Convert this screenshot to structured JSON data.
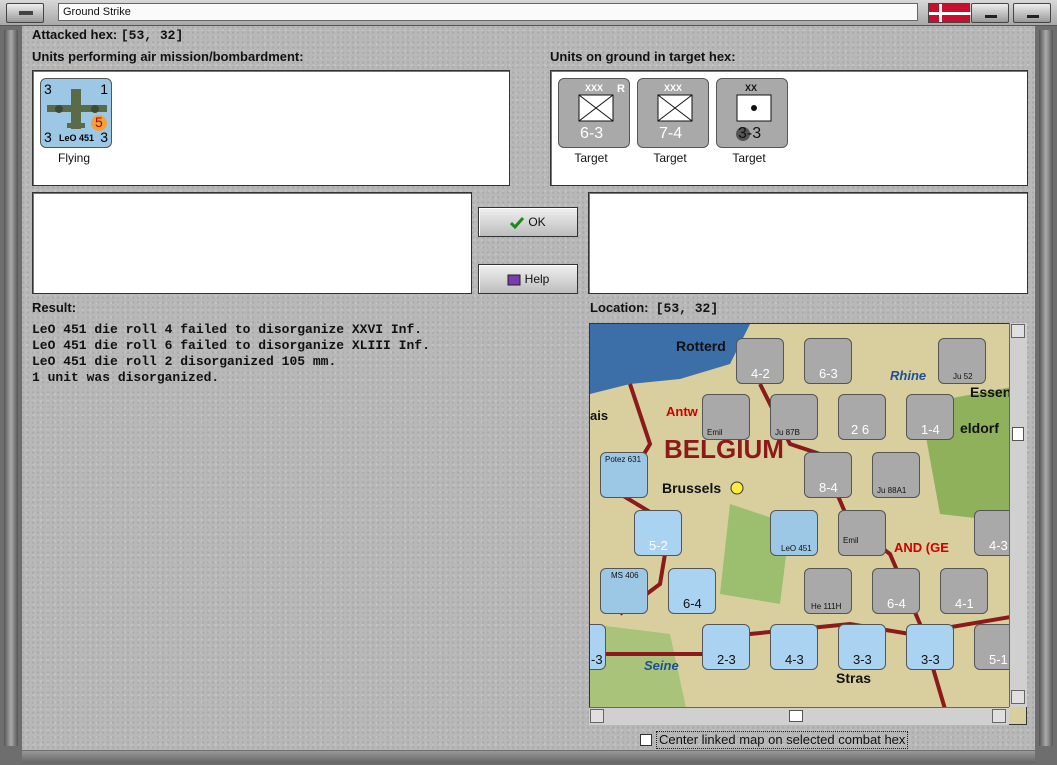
{
  "window": {
    "title": "Ground Strike"
  },
  "attacked_hex": {
    "label": "Attacked hex:",
    "value": "[53, 32]"
  },
  "air_units": {
    "heading": "Units performing air mission/bombardment:",
    "items": [
      {
        "name": "LeO 451",
        "top_left": "3",
        "top_right": "1",
        "bottom_left": "3",
        "bottom_right": "3",
        "badge": "5",
        "status": "Flying"
      }
    ]
  },
  "ground_units": {
    "heading": "Units on ground in target hex:",
    "items": [
      {
        "side_label": "XXVI Inf",
        "size": "XXX",
        "corner": "R",
        "strength": "6-3",
        "status": "Target"
      },
      {
        "side_label": "XLIII Inf",
        "size": "XXX",
        "corner": "",
        "strength": "7-4",
        "status": "Target"
      },
      {
        "side_label": "105 mm",
        "size": "XX",
        "corner": "",
        "strength": "3-3",
        "status": "Target"
      }
    ]
  },
  "buttons": {
    "ok": "OK",
    "help": "Help"
  },
  "result": {
    "label": "Result:",
    "lines": [
      "LeO 451 die roll 4 failed to disorganize XXVI Inf.",
      "LeO 451 die roll 6 failed to disorganize XLIII Inf.",
      "LeO 451 die roll 2 disorganized 105 mm.",
      "1 unit was disorganized."
    ]
  },
  "location": {
    "label": "Location:",
    "value": "[53, 32]"
  },
  "map": {
    "place_labels": [
      "Rotterd",
      "Antw",
      "BELGIUM",
      "Brussels",
      "Essen",
      "eldorf",
      "Rhine",
      "Seine",
      "AND (GE",
      "Stras",
      "ais"
    ],
    "units": [
      {
        "label": "4-2",
        "type": "ground-grey"
      },
      {
        "label": "6-3",
        "type": "ground-grey"
      },
      {
        "label": "Ju 52",
        "type": "air-grey"
      },
      {
        "label": "Emil",
        "type": "air-grey"
      },
      {
        "label": "Ju 87B",
        "type": "air-grey"
      },
      {
        "label": "2 6",
        "type": "ground-grey"
      },
      {
        "label": "1-4",
        "type": "ground-grey"
      },
      {
        "label": "Potez 631",
        "type": "air-blue"
      },
      {
        "label": "8-4",
        "type": "ground-grey"
      },
      {
        "label": "Ju 88A1",
        "type": "air-grey"
      },
      {
        "label": "5-2",
        "type": "ground-blue"
      },
      {
        "label": "LeO 451",
        "type": "air-blue"
      },
      {
        "label": "Emil",
        "type": "air-grey"
      },
      {
        "label": "4-3",
        "type": "ground-grey"
      },
      {
        "label": "MS 406",
        "type": "air-blue"
      },
      {
        "label": "6-4",
        "type": "ground-blue"
      },
      {
        "label": "He 111H",
        "type": "air-grey"
      },
      {
        "label": "6-4",
        "type": "ground-grey"
      },
      {
        "label": "4-1",
        "type": "ground-grey"
      },
      {
        "label": "2-3",
        "type": "ground-blue"
      },
      {
        "label": "4-3",
        "type": "ground-blue"
      },
      {
        "label": "3-3",
        "type": "ground-blue"
      },
      {
        "label": "3-3",
        "type": "ground-blue"
      },
      {
        "label": "5-1",
        "type": "ground-grey"
      },
      {
        "label": "-3",
        "type": "ground-blue"
      }
    ]
  },
  "checkbox": {
    "label": "Center linked map on selected combat hex",
    "checked": false
  },
  "colors": {
    "air_blue": "#9cc8e6",
    "ground_grey": "#a9a9a9",
    "ground_blue": "#a9d3f0",
    "border_red": "#8b1a1a"
  }
}
